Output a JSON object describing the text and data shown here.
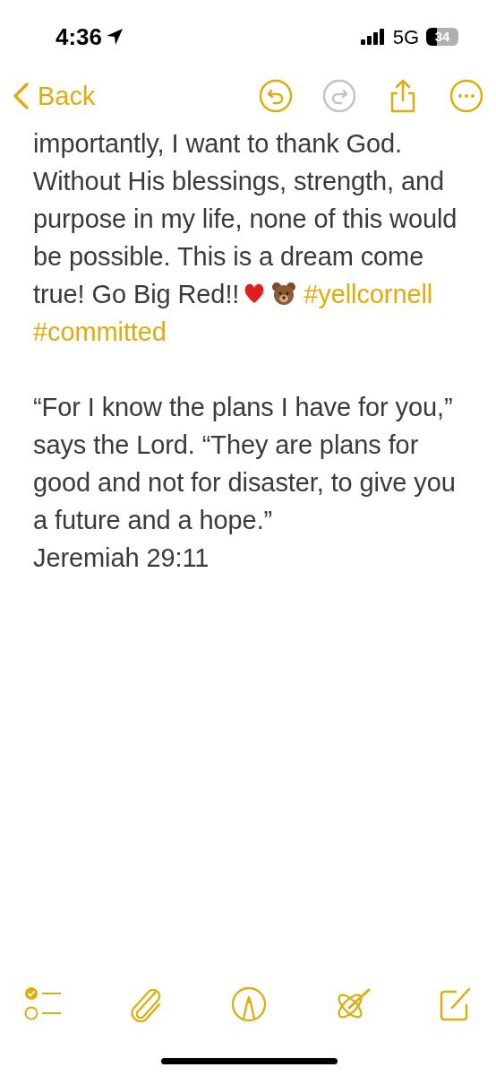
{
  "status_bar": {
    "time": "4:36",
    "network": "5G",
    "battery": "34"
  },
  "nav": {
    "back": "Back",
    "actions": [
      {
        "kind": "undo",
        "disabled": false
      },
      {
        "kind": "redo",
        "disabled": true
      },
      {
        "kind": "share",
        "disabled": false
      },
      {
        "kind": "more",
        "disabled": false
      }
    ]
  },
  "note": {
    "paragraphs": [
      {
        "lines": [
          "importantly, I want to thank God. Without His blessings, strength, and purpose in my life, none of this would be possible. This is a dream come",
          "true! Go Big Red!!"
        ],
        "stickers": [
          {
            "kind": "heart"
          },
          {
            "kind": "bear"
          }
        ],
        "hashtags": [
          "#yellcornell",
          "#committed"
        ]
      },
      {
        "lines": [
          "“For I know the plans I have for you,” says the Lord. “They are plans for good and not for disaster, to give you a future and a hope.”",
          "Jeremiah 29:11"
        ]
      }
    ]
  },
  "toolbar": [
    {
      "kind": "checklist"
    },
    {
      "kind": "attach"
    },
    {
      "kind": "markup"
    },
    {
      "kind": "writing"
    },
    {
      "kind": "compose"
    }
  ]
}
